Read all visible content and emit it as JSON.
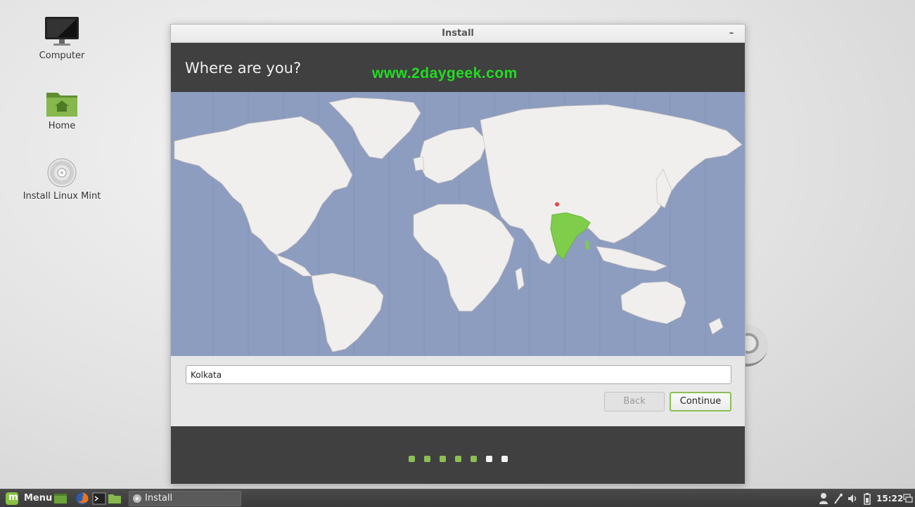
{
  "desktop": {
    "icons": [
      {
        "label": "Computer",
        "icon": "monitor-icon"
      },
      {
        "label": "Home",
        "icon": "home-folder-icon"
      },
      {
        "label": "Install Linux Mint",
        "icon": "disc-icon"
      }
    ]
  },
  "window": {
    "title": "Install",
    "minimize_label": "–",
    "heading": "Where are you?",
    "watermark": "www.2daygeek.com",
    "timezone_value": "Kolkata",
    "back_label": "Back",
    "continue_label": "Continue",
    "progress": {
      "total_steps": 7,
      "completed_steps": 5
    },
    "selected_region": "India",
    "colors": {
      "highlight": "#7fcd4b",
      "ocean": "#8d9dbf",
      "land": "#f1efee",
      "accent": "#8cbf55"
    }
  },
  "taskbar": {
    "menu_label": "Menu",
    "task_label": "Install",
    "clock": "15:22",
    "launchers": [
      "show-desktop-icon",
      "firefox-icon",
      "terminal-icon",
      "files-icon"
    ],
    "tray": [
      "user-icon",
      "network-icon",
      "volume-icon",
      "battery-icon",
      "display-icon"
    ]
  }
}
